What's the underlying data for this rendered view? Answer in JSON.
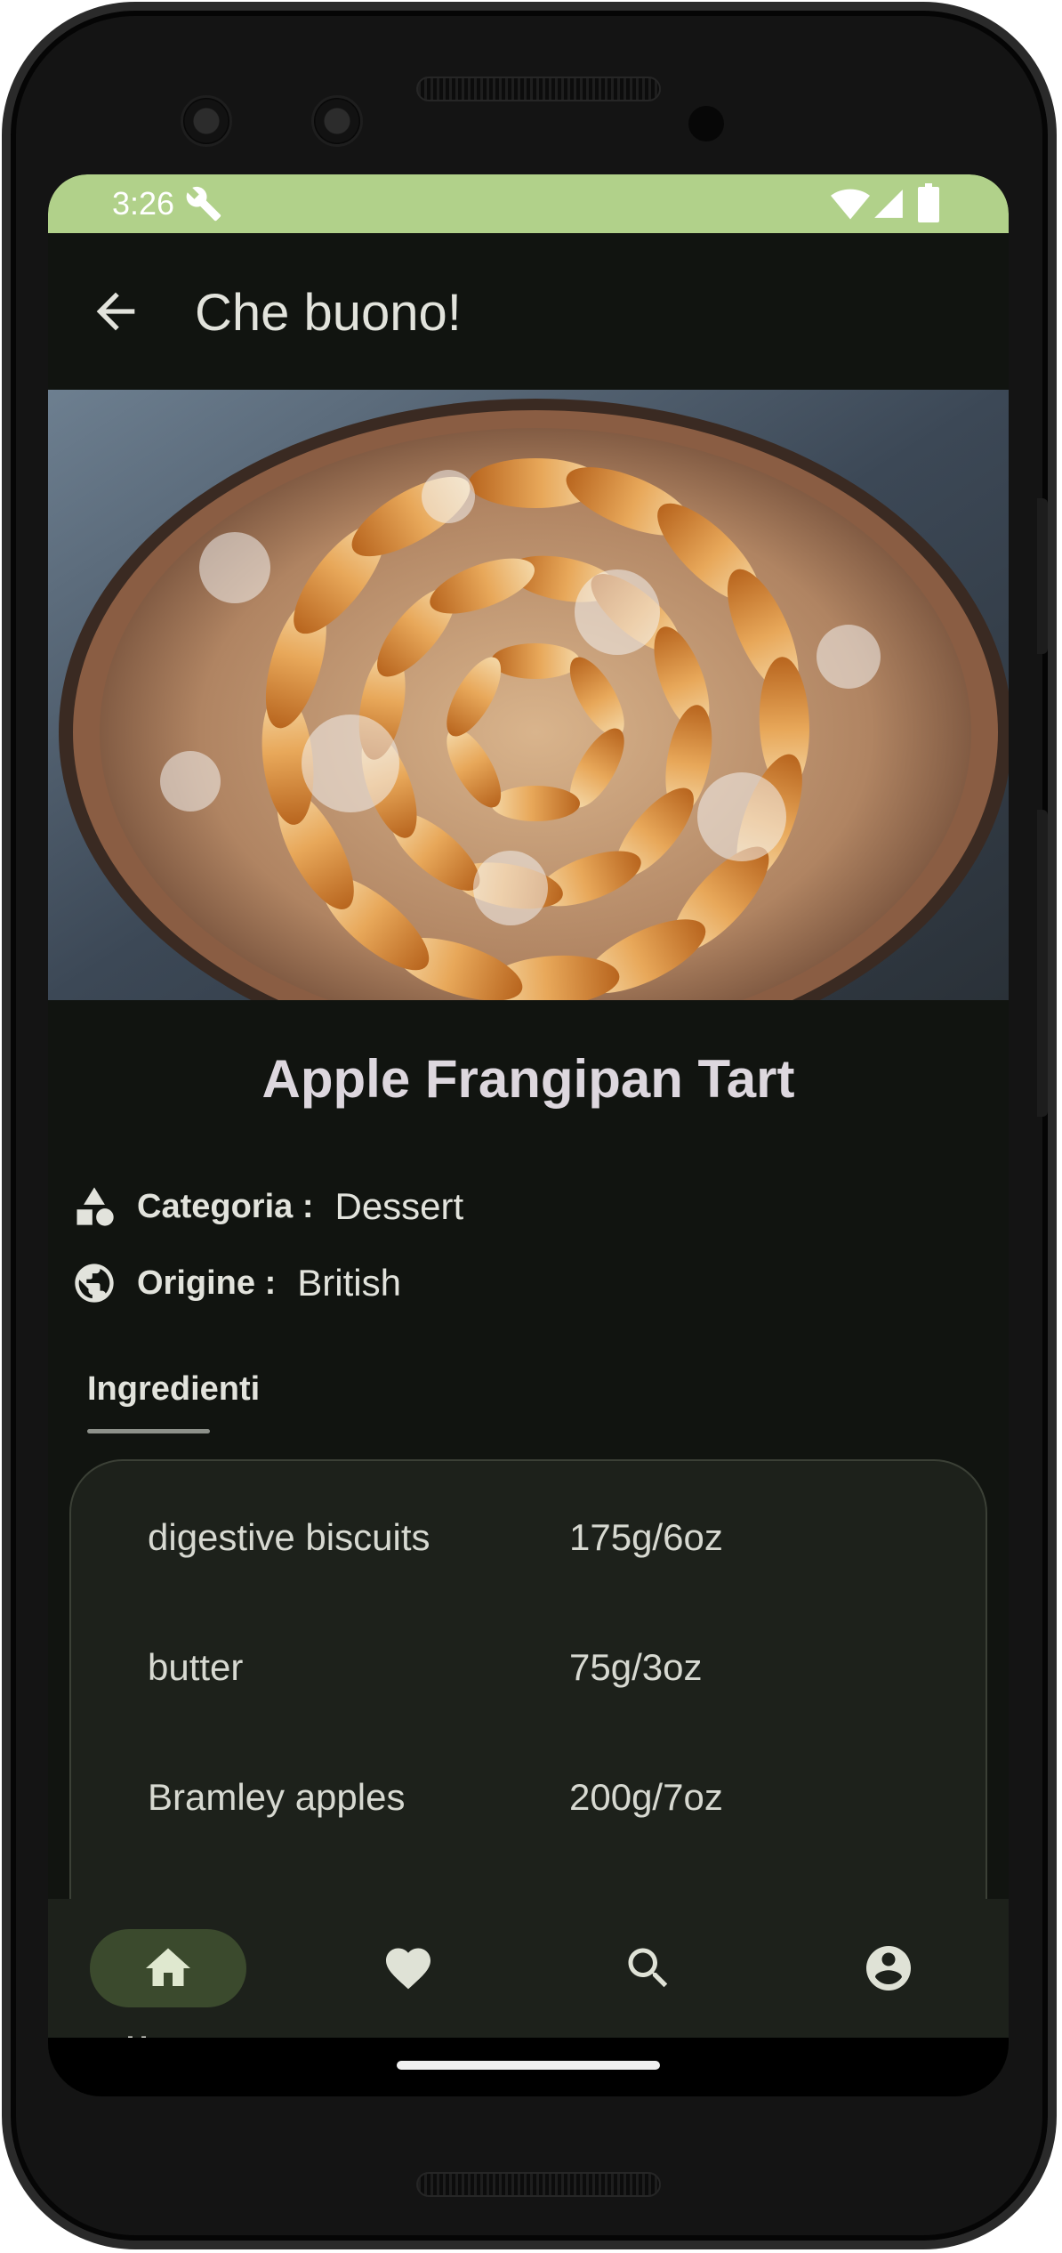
{
  "status_bar": {
    "time": "3:26"
  },
  "app_bar": {
    "title": "Che buono!"
  },
  "recipe": {
    "title": "Apple Frangipan Tart",
    "category_label": "Categoria :",
    "category_value": "Dessert",
    "origin_label": "Origine :",
    "origin_value": "British"
  },
  "tabs": [
    {
      "label": "Ingredienti",
      "selected": true
    }
  ],
  "ingredients": [
    {
      "name": "digestive biscuits",
      "quantity": "175g/6oz"
    },
    {
      "name": "butter",
      "quantity": "75g/3oz"
    },
    {
      "name": "Bramley apples",
      "quantity": "200g/7oz"
    }
  ],
  "bottom_nav": {
    "items": [
      {
        "label": "Home",
        "icon": "home-icon",
        "selected": true
      },
      {
        "label": "",
        "icon": "heart-icon",
        "selected": false
      },
      {
        "label": "",
        "icon": "search-icon",
        "selected": false
      },
      {
        "label": "",
        "icon": "account-circle-icon",
        "selected": false
      }
    ]
  },
  "colors": {
    "status_bar": "#b1d18a",
    "background": "#111410",
    "surface": "#1d211b",
    "nav_pill": "#3b4a2d",
    "on_surface": "#e2e3dc"
  }
}
